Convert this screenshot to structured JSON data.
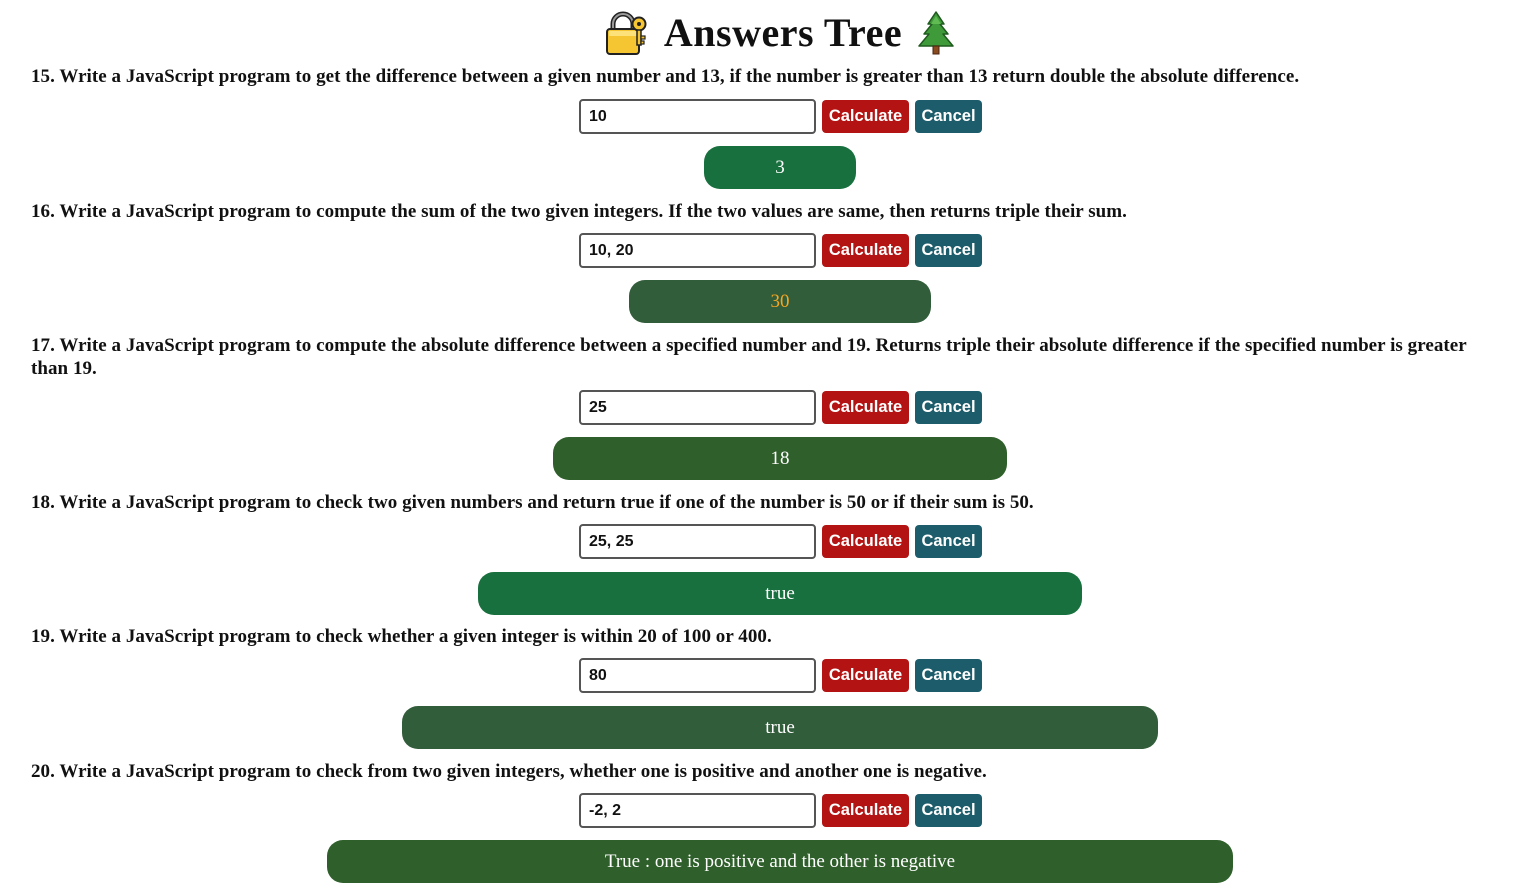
{
  "header": {
    "title": "Answers Tree",
    "left_icon": "lock-key-icon",
    "right_icon": "evergreen-tree-icon"
  },
  "colors": {
    "calculate_button": "#b31313",
    "cancel_button": "#1d5c6a"
  },
  "exercises": [
    {
      "question": "15. Write a JavaScript program to get the difference between a given number and 13, if the number is greater than 13 return double the absolute difference.",
      "input_value": "10",
      "calculate_label": "Calculate",
      "cancel_label": "Cancel",
      "result": "3",
      "result_bg": "#17703e",
      "result_color": "#ffffff"
    },
    {
      "question": "16. Write a JavaScript program to compute the sum of the two given integers. If the two values are same, then returns triple their sum.",
      "input_value": "10, 20",
      "calculate_label": "Calculate",
      "cancel_label": "Cancel",
      "result": "30",
      "result_bg": "#325d3a",
      "result_color": "#f5a623"
    },
    {
      "question": "17. Write a JavaScript program to compute the absolute difference between a specified number and 19. Returns triple their absolute difference if the specified number is greater than 19.",
      "input_value": "25",
      "calculate_label": "Calculate",
      "cancel_label": "Cancel",
      "result": "18",
      "result_bg": "#2f5f2b",
      "result_color": "#ffffff"
    },
    {
      "question": "18. Write a JavaScript program to check two given numbers and return true if one of the number is 50 or if their sum is 50.",
      "input_value": "25, 25",
      "calculate_label": "Calculate",
      "cancel_label": "Cancel",
      "result": "true",
      "result_bg": "#17703e",
      "result_color": "#ffffff"
    },
    {
      "question": "19. Write a JavaScript program to check whether a given integer is within 20 of 100 or 400.",
      "input_value": "80",
      "calculate_label": "Calculate",
      "cancel_label": "Cancel",
      "result": "true",
      "result_bg": "#325d3a",
      "result_color": "#ffffff"
    },
    {
      "question": "20. Write a JavaScript program to check from two given integers, whether one is positive and another one is negative.",
      "input_value": "-2, 2",
      "calculate_label": "Calculate",
      "cancel_label": "Cancel",
      "result": "True : one is positive and the other is negative",
      "result_bg": "#2f5f2b",
      "result_color": "#ffffff"
    }
  ]
}
